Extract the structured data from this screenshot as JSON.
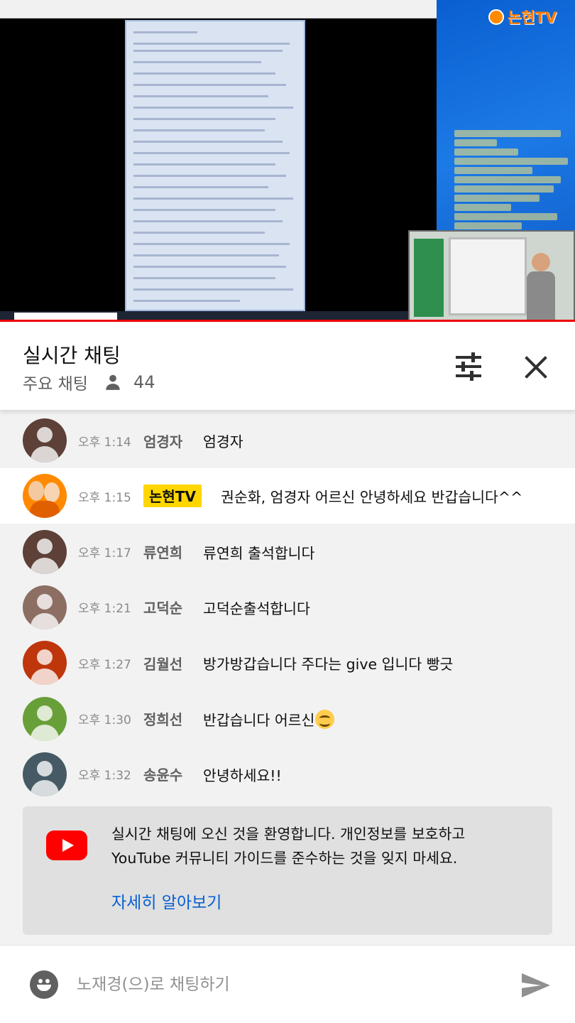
{
  "video": {
    "logo_text": "논현TV"
  },
  "header": {
    "title": "실시간 채팅",
    "mode_label": "주요 채팅",
    "viewer_count": "44",
    "icons": {
      "filter": "tune-icon",
      "close": "close-icon",
      "viewers": "person-icon"
    }
  },
  "messages": [
    {
      "time": "오후 1:14",
      "author": "엄경자",
      "text": "엄경자",
      "avatar_color": "#5d4037",
      "owner": false
    },
    {
      "time": "오후 1:15",
      "author": "논현TV",
      "text": "권순화, 엄경자 어르신 안녕하세요 반갑습니다^^",
      "avatar_color": "#ff8a00",
      "owner": true
    },
    {
      "time": "오후 1:17",
      "author": "류연희",
      "text": "류연희 출석합니다",
      "avatar_color": "#5d4037",
      "owner": false
    },
    {
      "time": "오후 1:21",
      "author": "고덕순",
      "text": "고덕순출석합니다",
      "avatar_color": "#8d6e63",
      "owner": false
    },
    {
      "time": "오후 1:27",
      "author": "김월선",
      "text": "방가방갑습니다 주다는 give 입니다 빵긋",
      "avatar_color": "#bf360c",
      "owner": false
    },
    {
      "time": "오후 1:30",
      "author": "정희선",
      "text": "반갑습니다 어르신",
      "emoji": "smiling-face-icon",
      "avatar_color": "#689f38",
      "owner": false
    },
    {
      "time": "오후 1:32",
      "author": "송윤수",
      "text": "안녕하세요!!",
      "avatar_color": "#455a64",
      "owner": false
    }
  ],
  "welcome": {
    "line1": "실시간 채팅에 오신 것을 환영합니다. 개인정보를 보호하고",
    "line2": "YouTube 커뮤니티 가이드를 준수하는 것을 잊지 마세요.",
    "learn_more": "자세히 알아보기",
    "icon": "youtube-logo-icon"
  },
  "input": {
    "placeholder": "노재경(으)로 채팅하기",
    "value": "",
    "icons": {
      "emoji": "emoji-icon",
      "send": "send-icon"
    }
  },
  "colors": {
    "owner_badge": "#ffd600",
    "link": "#065fd4",
    "youtube_red": "#ff0000",
    "chat_bg": "#f2f2f2",
    "progress": "#ee0000"
  }
}
